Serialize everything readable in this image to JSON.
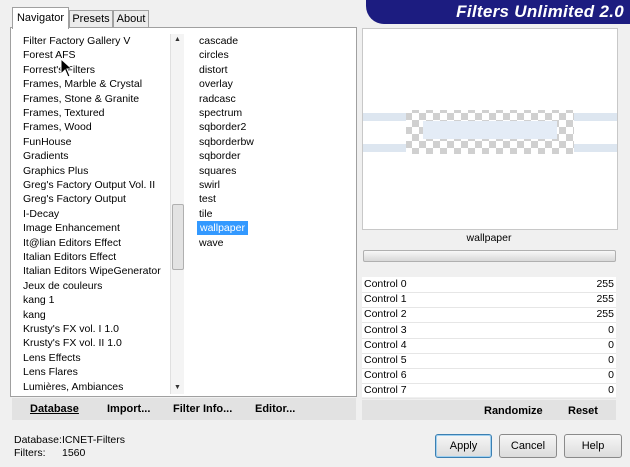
{
  "app": {
    "banner_title": "Filters Unlimited 2.0"
  },
  "tabs": [
    {
      "label": "Navigator"
    },
    {
      "label": "Presets"
    },
    {
      "label": "About"
    }
  ],
  "categories": [
    "Filter Factory Gallery V",
    "Forest AFS",
    "Forrest's Filters",
    "Frames, Marble & Crystal",
    "Frames, Stone & Granite",
    "Frames, Textured",
    "Frames, Wood",
    "FunHouse",
    "Gradients",
    "Graphics Plus",
    "Greg's Factory Output Vol. II",
    "Greg's Factory Output",
    "I-Decay",
    "Image Enhancement",
    "It@lian Editors Effect",
    "Italian Editors Effect",
    "Italian Editors WipeGenerator",
    "Jeux de couleurs",
    "kang 1",
    "kang",
    "Krusty's FX vol. I 1.0",
    "Krusty's FX vol. II 1.0",
    "Lens Effects",
    "Lens Flares",
    "Lumières, Ambiances"
  ],
  "filters": {
    "items": [
      "cascade",
      "circles",
      "distort",
      "overlay",
      "radcasc",
      "spectrum",
      "sqborder2",
      "sqborderbw",
      "sqborder",
      "squares",
      "swirl",
      "test",
      "tile",
      "wallpaper",
      "wave"
    ],
    "selected": "wallpaper"
  },
  "links": {
    "database": "Database",
    "import": "Import...",
    "filter_info": "Filter Info...",
    "editor": "Editor..."
  },
  "preview": {
    "label": "wallpaper"
  },
  "controls": [
    {
      "name": "Control 0",
      "value": "255"
    },
    {
      "name": "Control 1",
      "value": "255"
    },
    {
      "name": "Control 2",
      "value": "255"
    },
    {
      "name": "Control 3",
      "value": "0"
    },
    {
      "name": "Control 4",
      "value": "0"
    },
    {
      "name": "Control 5",
      "value": "0"
    },
    {
      "name": "Control 6",
      "value": "0"
    },
    {
      "name": "Control 7",
      "value": "0"
    }
  ],
  "actions": {
    "randomize": "Randomize",
    "reset": "Reset"
  },
  "status": {
    "database_label": "Database:",
    "database_value": "ICNET-Filters",
    "filters_label": "Filters:",
    "filters_value": "1560"
  },
  "buttons": {
    "apply": "Apply",
    "cancel": "Cancel",
    "help": "Help"
  },
  "icons": {
    "cursor": "arrow-cursor-icon",
    "scroll_up": "scroll-up-arrow-icon",
    "scroll_down": "scroll-down-arrow-icon"
  },
  "colors": {
    "banner": "#1c1c80",
    "selection": "#3399ff"
  }
}
